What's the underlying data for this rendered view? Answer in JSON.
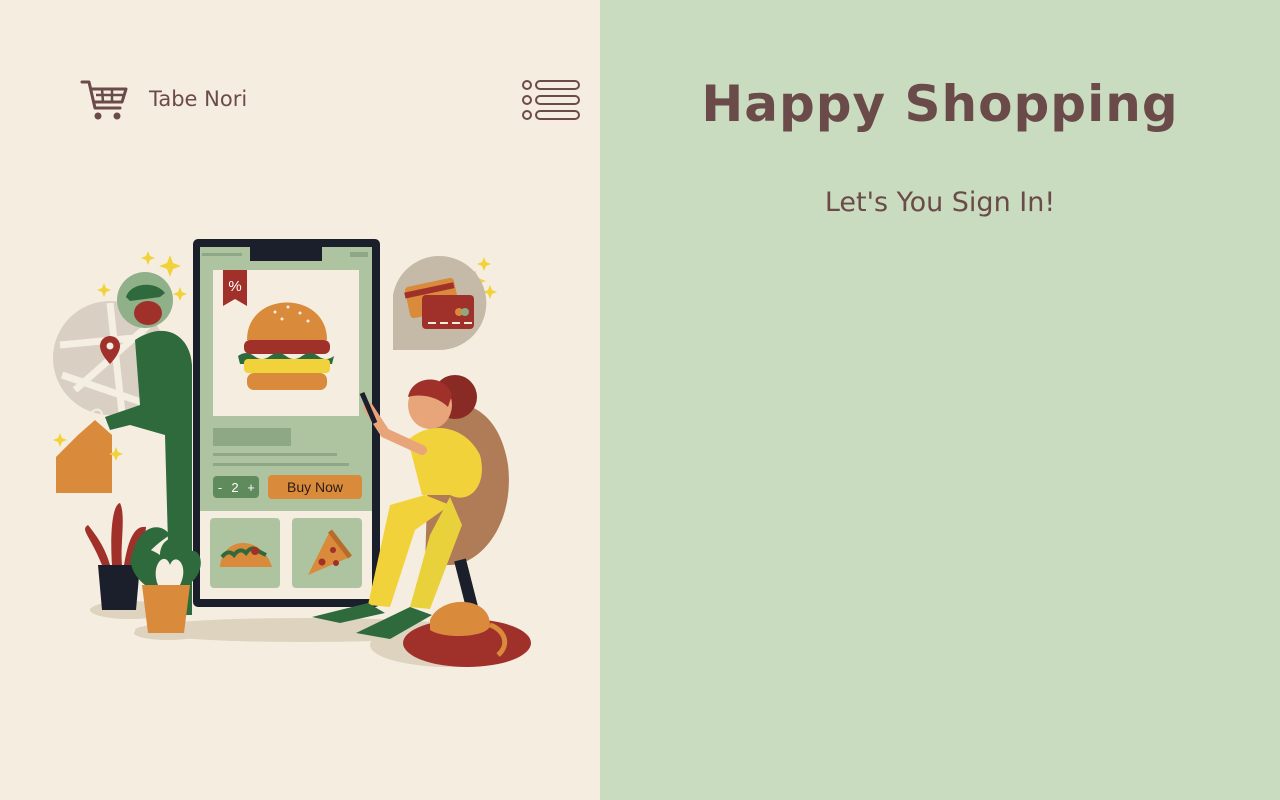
{
  "header": {
    "brand_name": "Tabe Nori",
    "logo_icon": "cart-icon",
    "menu_icon": "list-menu-icon"
  },
  "hero": {
    "title": "Happy Shopping",
    "subtitle": "Let's You Sign In!"
  },
  "illustration": {
    "discount_tag": "%",
    "quantity": {
      "minus": "-",
      "value": "2",
      "plus": "+"
    },
    "buy_button_label": "Buy Now"
  },
  "colors": {
    "left_panel_bg": "#f5eee0",
    "right_panel_bg": "#c9dcbf",
    "text_primary": "#6b4a4a",
    "button_orange": "#d98a3a",
    "dark_green": "#2f5e3a"
  }
}
